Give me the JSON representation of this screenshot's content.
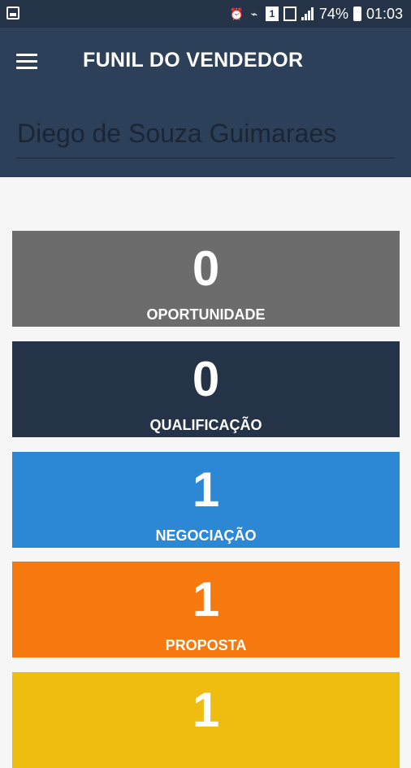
{
  "status_bar": {
    "battery": "74%",
    "time": "01:03",
    "icons": [
      "image-icon",
      "alarm-icon",
      "wifi-icon",
      "sim1-icon",
      "signal-icon",
      "signal-icon",
      "battery-icon"
    ]
  },
  "app_bar": {
    "title": "FUNIL DO VENDEDOR",
    "menu_icon": "hamburger-menu-icon",
    "seller_name": "Diego de Souza Guimaraes",
    "background": "#2d4059"
  },
  "funnel": {
    "stages": [
      {
        "count": "0",
        "label": "OPORTUNIDADE",
        "color": "#6c6c6c"
      },
      {
        "count": "0",
        "label": "QUALIFICAÇÃO",
        "color": "#253348"
      },
      {
        "count": "1",
        "label": "NEGOCIAÇÃO",
        "color": "#2c87d4"
      },
      {
        "count": "1",
        "label": "PROPOSTA",
        "color": "#f5790f"
      },
      {
        "count": "1",
        "label": "",
        "color": "#eebd0f"
      }
    ]
  }
}
